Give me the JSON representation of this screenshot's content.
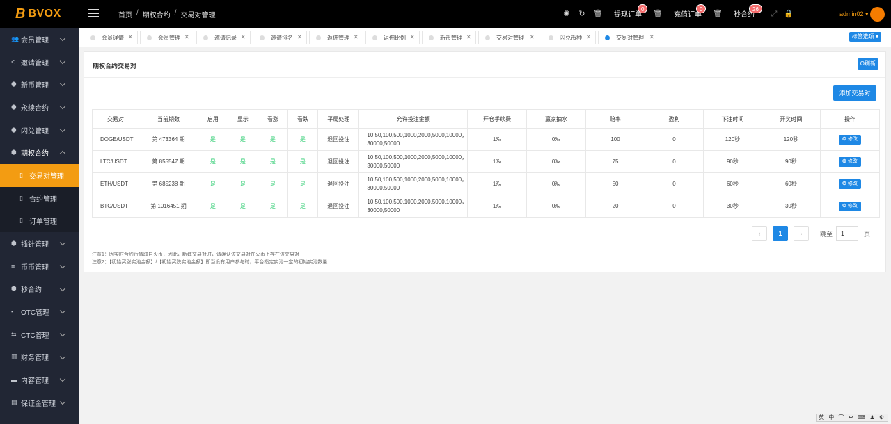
{
  "brand": {
    "mark": "B",
    "name": "BVOX"
  },
  "breadcrumb": {
    "items": [
      "首页",
      "期权合约",
      "交易对管理"
    ],
    "sep": "/"
  },
  "toolbar": {
    "withdraw_label": "提现订单",
    "withdraw_badge": "0",
    "recharge_label": "充值订单",
    "recharge_badge": "0",
    "second_label": "秒合约",
    "second_badge": "26",
    "user": "admin02 ▾"
  },
  "sidebar": {
    "items": [
      {
        "label": "会员管理"
      },
      {
        "label": "邀请管理"
      },
      {
        "label": "新币管理"
      },
      {
        "label": "永续合约"
      },
      {
        "label": "闪兑管理"
      },
      {
        "label": "期权合约"
      },
      {
        "label": "交易对管理"
      },
      {
        "label": "合约管理"
      },
      {
        "label": "订单管理"
      },
      {
        "label": "插针管理"
      },
      {
        "label": "币币管理"
      },
      {
        "label": "秒合约"
      },
      {
        "label": "OTC管理"
      },
      {
        "label": "CTC管理"
      },
      {
        "label": "财务管理"
      },
      {
        "label": "内容管理"
      },
      {
        "label": "保证金管理"
      }
    ]
  },
  "tabs": [
    "会员详情",
    "会员管理",
    "邀请记录",
    "邀请排名",
    "返佣管理",
    "返佣比例",
    "新币管理",
    "交易对管理",
    "闪兑币种",
    "交易对管理"
  ],
  "tab_select_label": "标签选项 ▾",
  "panel": {
    "title": "期权合约交易对",
    "refresh_label": "O刷新",
    "add_label": "添加交易对"
  },
  "table": {
    "headers": [
      "交易对",
      "当前期数",
      "启用",
      "显示",
      "看涨",
      "看跌",
      "平局处理",
      "允许投注金额",
      "开仓手续费",
      "赢家抽水",
      "赔率",
      "盈利",
      "下注时间",
      "开奖时间",
      "操作"
    ],
    "rows": [
      {
        "pair": "DOGE/USDT",
        "period": "第 473364 期",
        "enabled": "是",
        "shown": "是",
        "up": "是",
        "down": "是",
        "draw": "退回投注",
        "amounts": "10,50,100,500,1000,2000,5000,10000，30000,50000",
        "fee": "1‰",
        "rake": "0‰",
        "odds": "100",
        "profit": "0",
        "bet_time": "120秒",
        "draw_time": "120秒",
        "action": "❂ 修改"
      },
      {
        "pair": "LTC/USDT",
        "period": "第 855547 期",
        "enabled": "是",
        "shown": "是",
        "up": "是",
        "down": "是",
        "draw": "退回投注",
        "amounts": "10,50,100,500,1000,2000,5000,10000，30000,50000",
        "fee": "1‰",
        "rake": "0‰",
        "odds": "75",
        "profit": "0",
        "bet_time": "90秒",
        "draw_time": "90秒",
        "action": "❂ 修改"
      },
      {
        "pair": "ETH/USDT",
        "period": "第 685238 期",
        "enabled": "是",
        "shown": "是",
        "up": "是",
        "down": "是",
        "draw": "退回投注",
        "amounts": "10,50,100,500,1000,2000,5000,10000，30000,50000",
        "fee": "1‰",
        "rake": "0‰",
        "odds": "50",
        "profit": "0",
        "bet_time": "60秒",
        "draw_time": "60秒",
        "action": "❂ 修改"
      },
      {
        "pair": "BTC/USDT",
        "period": "第 1016451 期",
        "enabled": "是",
        "shown": "是",
        "up": "是",
        "down": "是",
        "draw": "退回投注",
        "amounts": "10,50,100,500,1000,2000,5000,10000，30000,50000",
        "fee": "1‰",
        "rake": "0‰",
        "odds": "20",
        "profit": "0",
        "bet_time": "30秒",
        "draw_time": "30秒",
        "action": "❂ 修改"
      }
    ]
  },
  "pager": {
    "prev": "‹",
    "current": "1",
    "next": "›",
    "goto_label": "跳至",
    "goto_value": "1",
    "page_label": "页"
  },
  "notes": [
    "注意1：因实时合约行情取自火币，因此，新建交易对时，请确认该交易对在火币上存在该交易对",
    "注意2：【初始买涨实池金额】/【初始买跌实池金额】即当没有用户参与时，平台指定实池一定的初始实池数量"
  ],
  "ime_bar": "英 中 ⌒ ↩ ⌨ ♟ ⚙"
}
